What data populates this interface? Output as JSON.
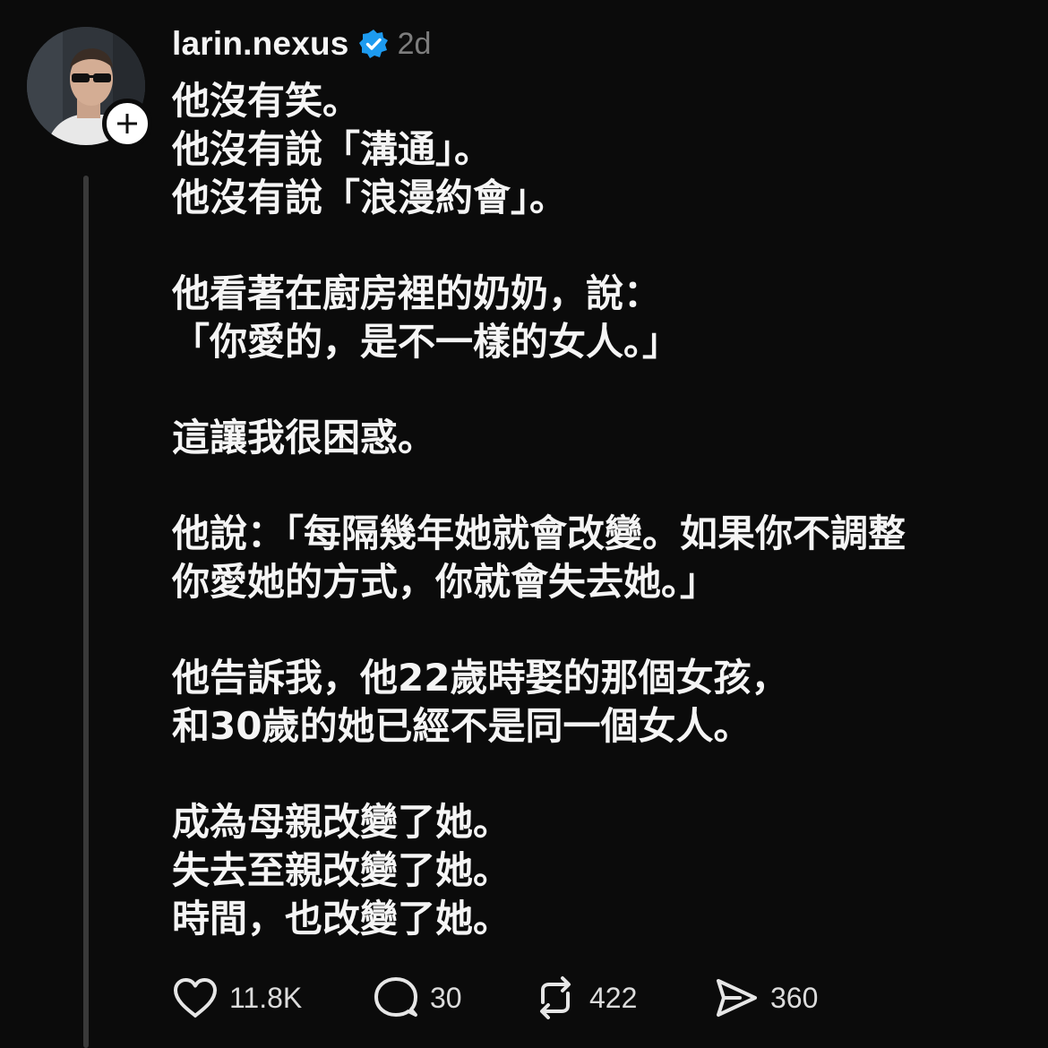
{
  "post": {
    "username": "larin.nexus",
    "timestamp": "2d",
    "paragraphs": [
      [
        "他沒有笑。",
        "他沒有說「溝通」。",
        "他沒有說「浪漫約會」。"
      ],
      [
        "他看著在廚房裡的奶奶，說：",
        "「你愛的，是不一樣的女人。」"
      ],
      [
        "這讓我很困惑。"
      ],
      [
        "他說：「每隔幾年她就會改變。如果你不調整",
        "你愛她的方式，你就會失去她。」"
      ],
      [
        "他告訴我，他22歲時娶的那個女孩，",
        "和30歲的她已經不是同一個女人。"
      ],
      [
        "成為母親改變了她。",
        "失去至親改變了她。",
        "時間，也改變了她。"
      ]
    ]
  },
  "actions": {
    "likes": "11.8K",
    "replies": "30",
    "reposts": "422",
    "shares": "360"
  },
  "colors": {
    "background": "#0b0b0b",
    "text": "#f5f5f5",
    "muted": "#7d7d7d",
    "verified": "#1d9bf0",
    "thread_line": "#3a3a3a"
  },
  "icons": {
    "verified": "verified-badge-icon",
    "follow": "plus-icon",
    "like": "heart-icon",
    "reply": "comment-bubble-icon",
    "repost": "repost-icon",
    "share": "send-icon"
  }
}
